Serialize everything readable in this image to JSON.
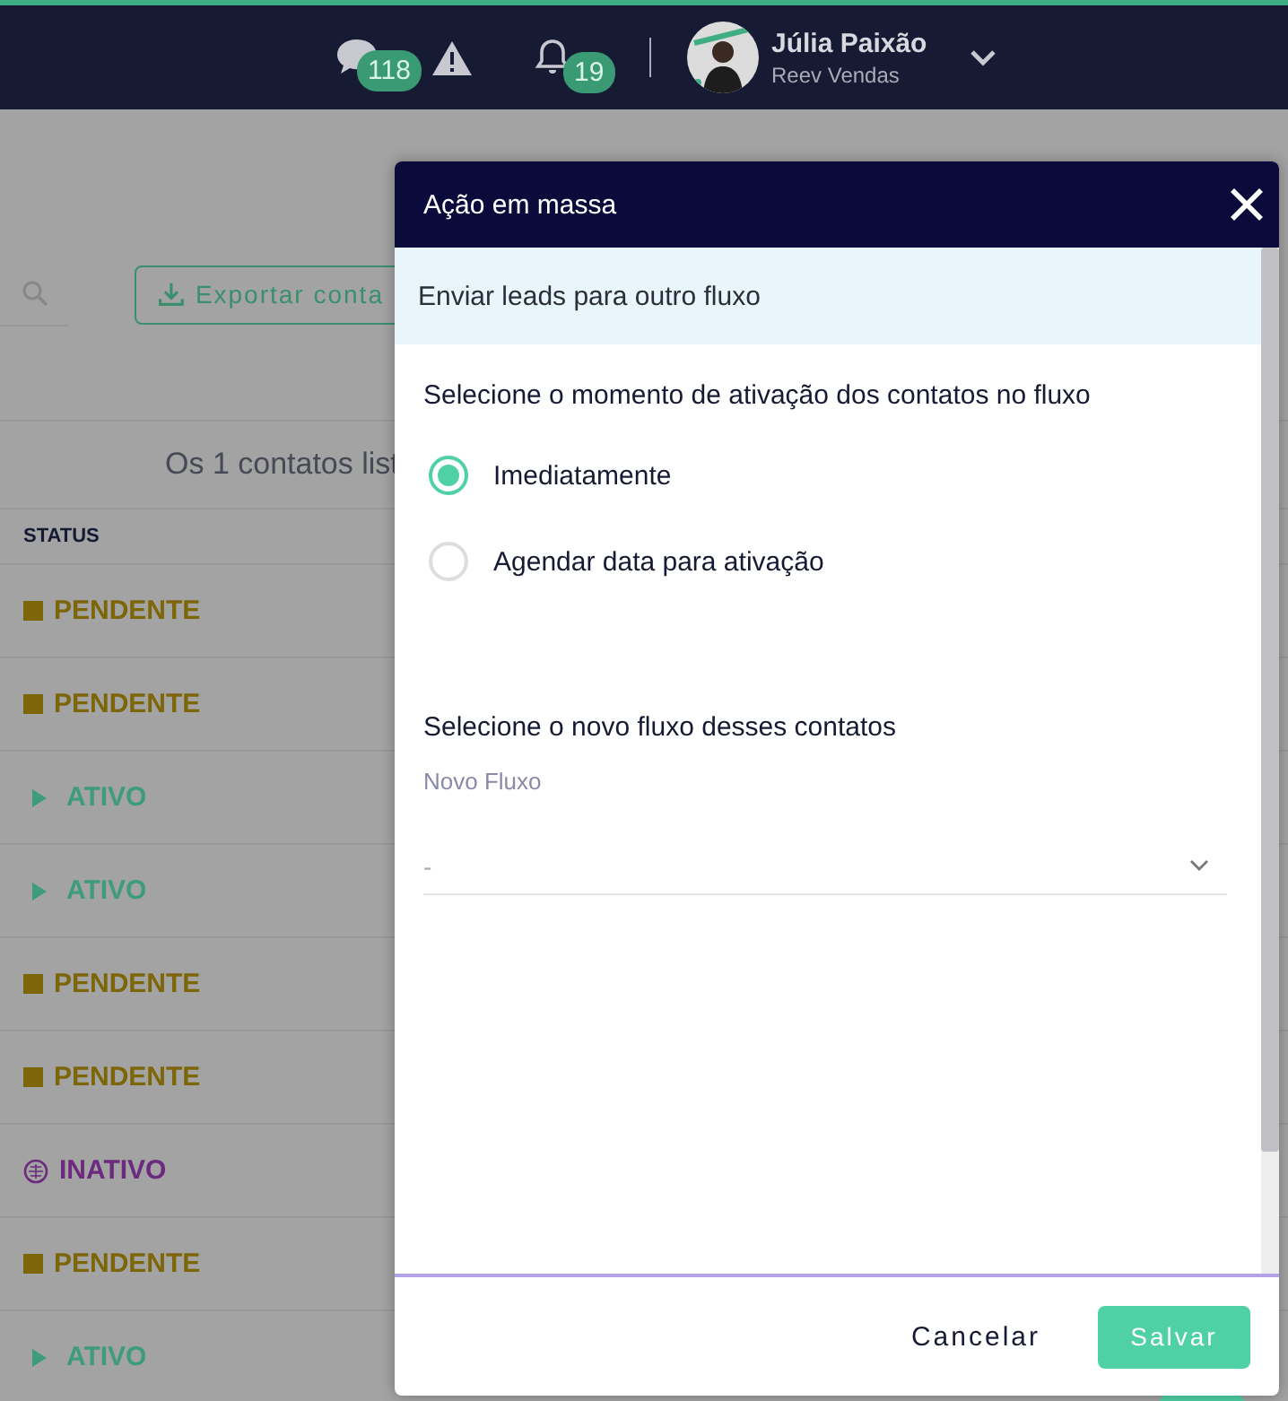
{
  "top_bar": {
    "chat_count": "118",
    "notification_count": "19",
    "user": {
      "name": "Júlia Paixão",
      "company": "Reev Vendas"
    }
  },
  "background": {
    "export_button": "Exportar conta",
    "summary": "Os 1 contatos list",
    "table": {
      "columns": [
        "STATUS"
      ],
      "rows": [
        {
          "status": "PENDENTE",
          "kind": "pendente"
        },
        {
          "status": "PENDENTE",
          "kind": "pendente"
        },
        {
          "status": "ATIVO",
          "kind": "ativo"
        },
        {
          "status": "ATIVO",
          "kind": "ativo"
        },
        {
          "status": "PENDENTE",
          "kind": "pendente"
        },
        {
          "status": "PENDENTE",
          "kind": "pendente"
        },
        {
          "status": "INATIVO",
          "kind": "inativo"
        },
        {
          "status": "PENDENTE",
          "kind": "pendente"
        },
        {
          "status": "ATIVO",
          "kind": "ativo"
        }
      ]
    }
  },
  "modal": {
    "title": "Ação em massa",
    "subtitle": "Enviar leads para outro fluxo",
    "activation_question": "Selecione o momento de ativação dos contatos no fluxo",
    "options": [
      {
        "label": "Imediatamente",
        "selected": true
      },
      {
        "label": "Agendar data para ativação",
        "selected": false
      }
    ],
    "flow_question": "Selecione o novo fluxo desses contatos",
    "flow_field": {
      "label": "Novo Fluxo",
      "value": "-"
    },
    "buttons": {
      "cancel": "Cancelar",
      "save": "Salvar"
    }
  }
}
